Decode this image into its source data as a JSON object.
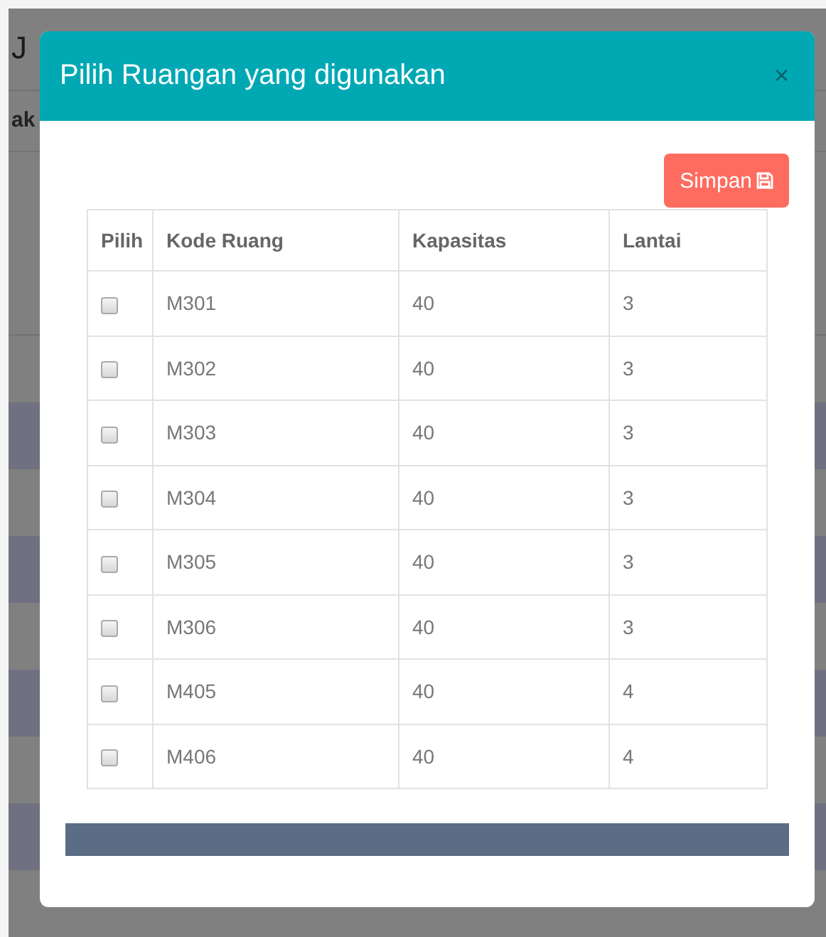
{
  "background": {
    "heading": "J",
    "subheading": "ak"
  },
  "dialog": {
    "title": "Pilih Ruangan yang digunakan",
    "close": "×",
    "save_button": "Simpan"
  },
  "table": {
    "columns": [
      "Pilih",
      "Kode Ruang",
      "Kapasitas",
      "Lantai"
    ],
    "rows": [
      {
        "checked": false,
        "code": "M301",
        "capacity": "40",
        "floor": "3"
      },
      {
        "checked": false,
        "code": "M302",
        "capacity": "40",
        "floor": "3"
      },
      {
        "checked": false,
        "code": "M303",
        "capacity": "40",
        "floor": "3"
      },
      {
        "checked": false,
        "code": "M304",
        "capacity": "40",
        "floor": "3"
      },
      {
        "checked": false,
        "code": "M305",
        "capacity": "40",
        "floor": "3"
      },
      {
        "checked": false,
        "code": "M306",
        "capacity": "40",
        "floor": "3"
      },
      {
        "checked": false,
        "code": "M405",
        "capacity": "40",
        "floor": "4"
      },
      {
        "checked": false,
        "code": "M406",
        "capacity": "40",
        "floor": "4"
      }
    ]
  }
}
